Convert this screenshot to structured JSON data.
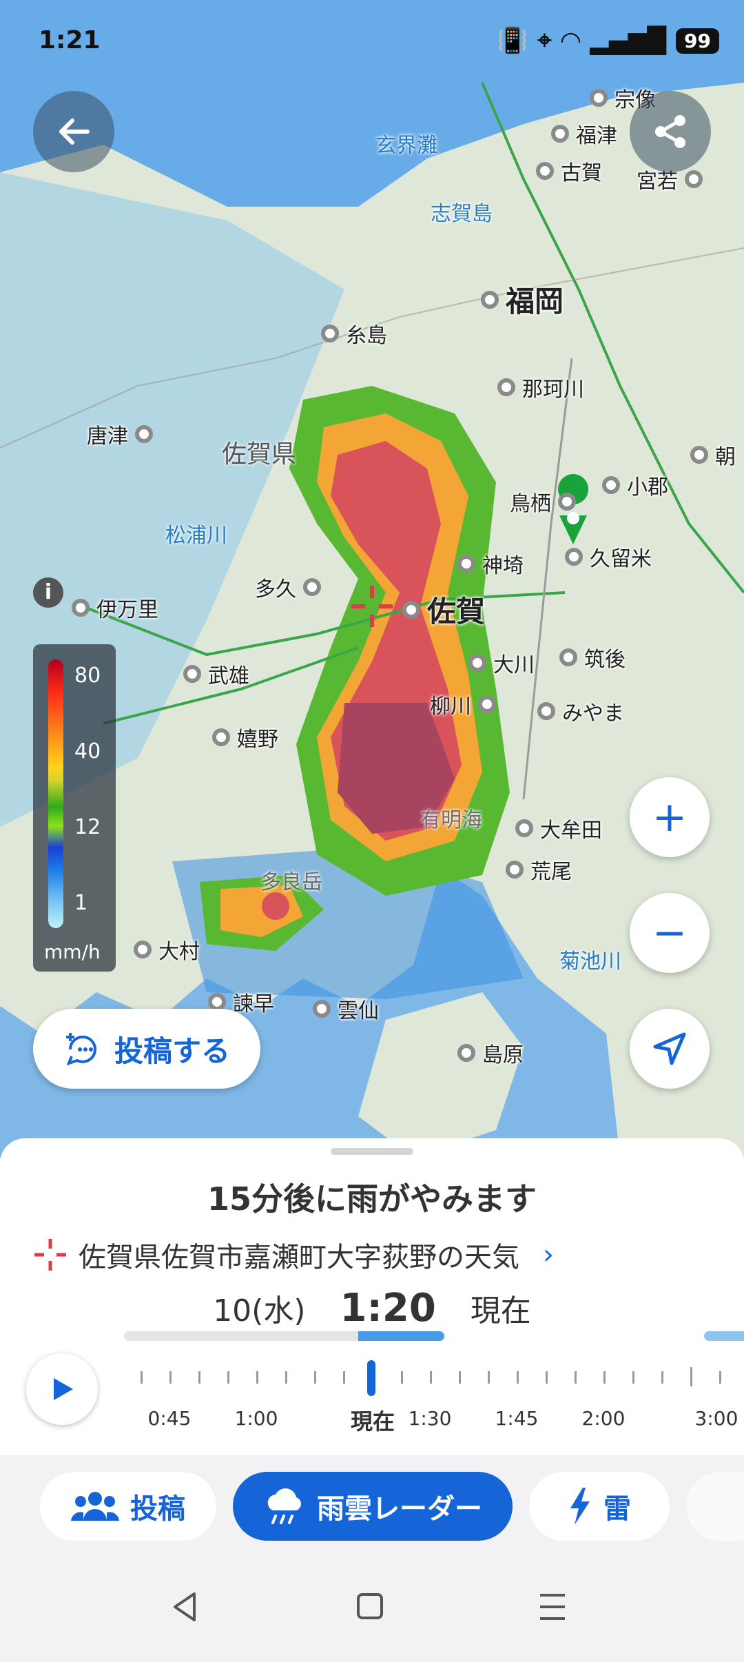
{
  "status_bar": {
    "time": "1:21",
    "battery": "99"
  },
  "map": {
    "regions": [
      "佐賀県"
    ],
    "water_labels": [
      "玄界灘",
      "志賀島",
      "松浦川",
      "有明海",
      "多良岳",
      "菊池川"
    ],
    "places": [
      {
        "name": "宗像"
      },
      {
        "name": "福津"
      },
      {
        "name": "古賀"
      },
      {
        "name": "宮若"
      },
      {
        "name": "福岡",
        "big": true
      },
      {
        "name": "糸島"
      },
      {
        "name": "那珂川"
      },
      {
        "name": "唐津"
      },
      {
        "name": "小郡"
      },
      {
        "name": "鳥栖"
      },
      {
        "name": "神埼"
      },
      {
        "name": "久留米"
      },
      {
        "name": "多久"
      },
      {
        "name": "佐賀",
        "big": true
      },
      {
        "name": "伊万里"
      },
      {
        "name": "武雄"
      },
      {
        "name": "大川"
      },
      {
        "name": "筑後"
      },
      {
        "name": "柳川"
      },
      {
        "name": "みやま"
      },
      {
        "name": "嬉野"
      },
      {
        "name": "大牟田"
      },
      {
        "name": "荒尾"
      },
      {
        "name": "大村"
      },
      {
        "name": "諫早"
      },
      {
        "name": "雲仙"
      },
      {
        "name": "島原"
      },
      {
        "name": "朝"
      }
    ],
    "legend": {
      "values": [
        "80",
        "40",
        "12",
        "1"
      ],
      "unit": "mm/h"
    },
    "post_button_label": "投稿する",
    "zoom_in": "+",
    "zoom_out": "−"
  },
  "sheet": {
    "headline": "15分後に雨がやみます",
    "location": "佐賀県佐賀市嘉瀬町大字荻野の天気",
    "date": "10(水)",
    "time": "1:20",
    "now_label": "現在",
    "timeline_labels": [
      "0:45",
      "1:00",
      "現在",
      "1:30",
      "1:45",
      "2:00",
      "3:00"
    ]
  },
  "tabs": [
    {
      "label": "投稿",
      "icon": "people-icon",
      "active": false
    },
    {
      "label": "雨雲レーダー",
      "icon": "rain-cloud-icon",
      "active": true
    },
    {
      "label": "雷",
      "icon": "lightning-icon",
      "active": false
    }
  ],
  "colors": {
    "accent": "#1565d8",
    "marker": "#1aa33a",
    "crosshair": "#e23a4a"
  }
}
